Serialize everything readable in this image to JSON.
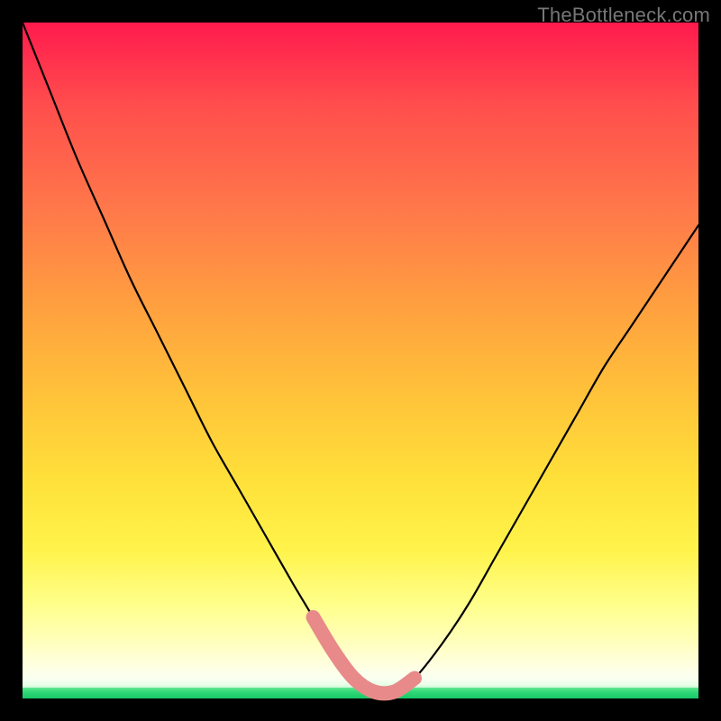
{
  "watermark": "TheBottleneck.com",
  "chart_data": {
    "type": "line",
    "title": "",
    "xlabel": "",
    "ylabel": "",
    "xlim": [
      0,
      100
    ],
    "ylim": [
      0,
      100
    ],
    "series": [
      {
        "name": "black-curve",
        "x": [
          0,
          4,
          8,
          12,
          16,
          20,
          24,
          28,
          32,
          36,
          40,
          43,
          46,
          49,
          52,
          55,
          58,
          62,
          66,
          70,
          74,
          78,
          82,
          86,
          90,
          94,
          98,
          100
        ],
        "values": [
          100,
          90,
          80,
          71,
          62,
          54,
          46,
          38,
          31,
          24,
          17,
          12,
          7,
          3,
          1,
          1,
          3,
          8,
          14,
          21,
          28,
          35,
          42,
          49,
          55,
          61,
          67,
          70
        ]
      },
      {
        "name": "pink-highlight",
        "x": [
          43,
          46,
          49,
          52,
          55,
          58
        ],
        "values": [
          12,
          7,
          3,
          1,
          1,
          3
        ]
      }
    ],
    "colors": {
      "black_curve": "#000000",
      "pink_highlight": "#e88a8a",
      "gradient_top": "#ff1a4d",
      "gradient_mid": "#ffe13a",
      "gradient_green": "#30d878"
    }
  }
}
